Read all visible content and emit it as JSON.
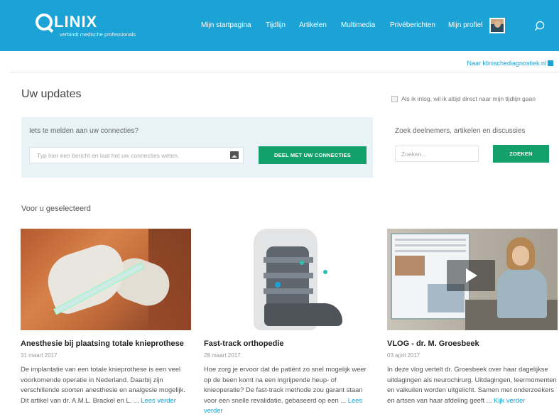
{
  "brand": {
    "name": "LINIX",
    "tagline": "verbindt medische professionals"
  },
  "nav": {
    "items": [
      "Mijn startpagina",
      "Tijdlijn",
      "Artikelen",
      "Multimedia",
      "Privéberichten",
      "Mijn profiel"
    ]
  },
  "external_link": "Naar klinischediagnostiek.nl",
  "updates": {
    "heading": "Uw updates",
    "login_pref": "Als ik inlog, wil ik altijd direct naar mijn tijdlijn gaan"
  },
  "post": {
    "question": "Iets te melden aan uw connecties?",
    "placeholder": "Typ hier een bericht en laat het uw connecties weten.",
    "button": "DEEL MET UW CONNECTIES"
  },
  "search": {
    "label": "Zoek deelnemers, artikelen en discussies",
    "placeholder": "Zoeken...",
    "button": "ZOEKEN"
  },
  "selected_heading": "Voor u geselecteerd",
  "cards": [
    {
      "title": "Anesthesie bij plaatsing totale knieprothese",
      "date": "31 maart 2017",
      "text": "De implantatie van een totale knieprothese is een veel voorkomende operatie in Nederland. Daarbij zijn verschillende soorten anesthesie en analgesie mogelijk. Dit artikel van dr. A.M.L. Brackel en L. ...",
      "more": "Lees verder"
    },
    {
      "title": "Fast-track orthopedie",
      "date": "28 maart 2017",
      "text": "Hoe zorg je ervoor dat de patiënt zo snel mogelijk weer op de been komt na een ingrijpende heup- of knieoperatie? De fast-track methode zou garant staan voor een snelle revalidatie, gebaseerd op een ...",
      "more": "Lees verder"
    },
    {
      "title": "VLOG - dr. M. Groesbeek",
      "date": "03 april 2017",
      "text": "In deze vlog vertelt dr. Groesbeek over haar dagelijkse uitdagingen als neurochirurg. Uitdagingen, leermomenten en valkuilen worden uitgelicht. Samen met onderzoekers en artsen van haar afdeling geeft ...",
      "more": "Kijk verder"
    }
  ],
  "colors": {
    "header": "#1aa3d4",
    "button": "#14a06b",
    "link": "#1aa3d4"
  }
}
